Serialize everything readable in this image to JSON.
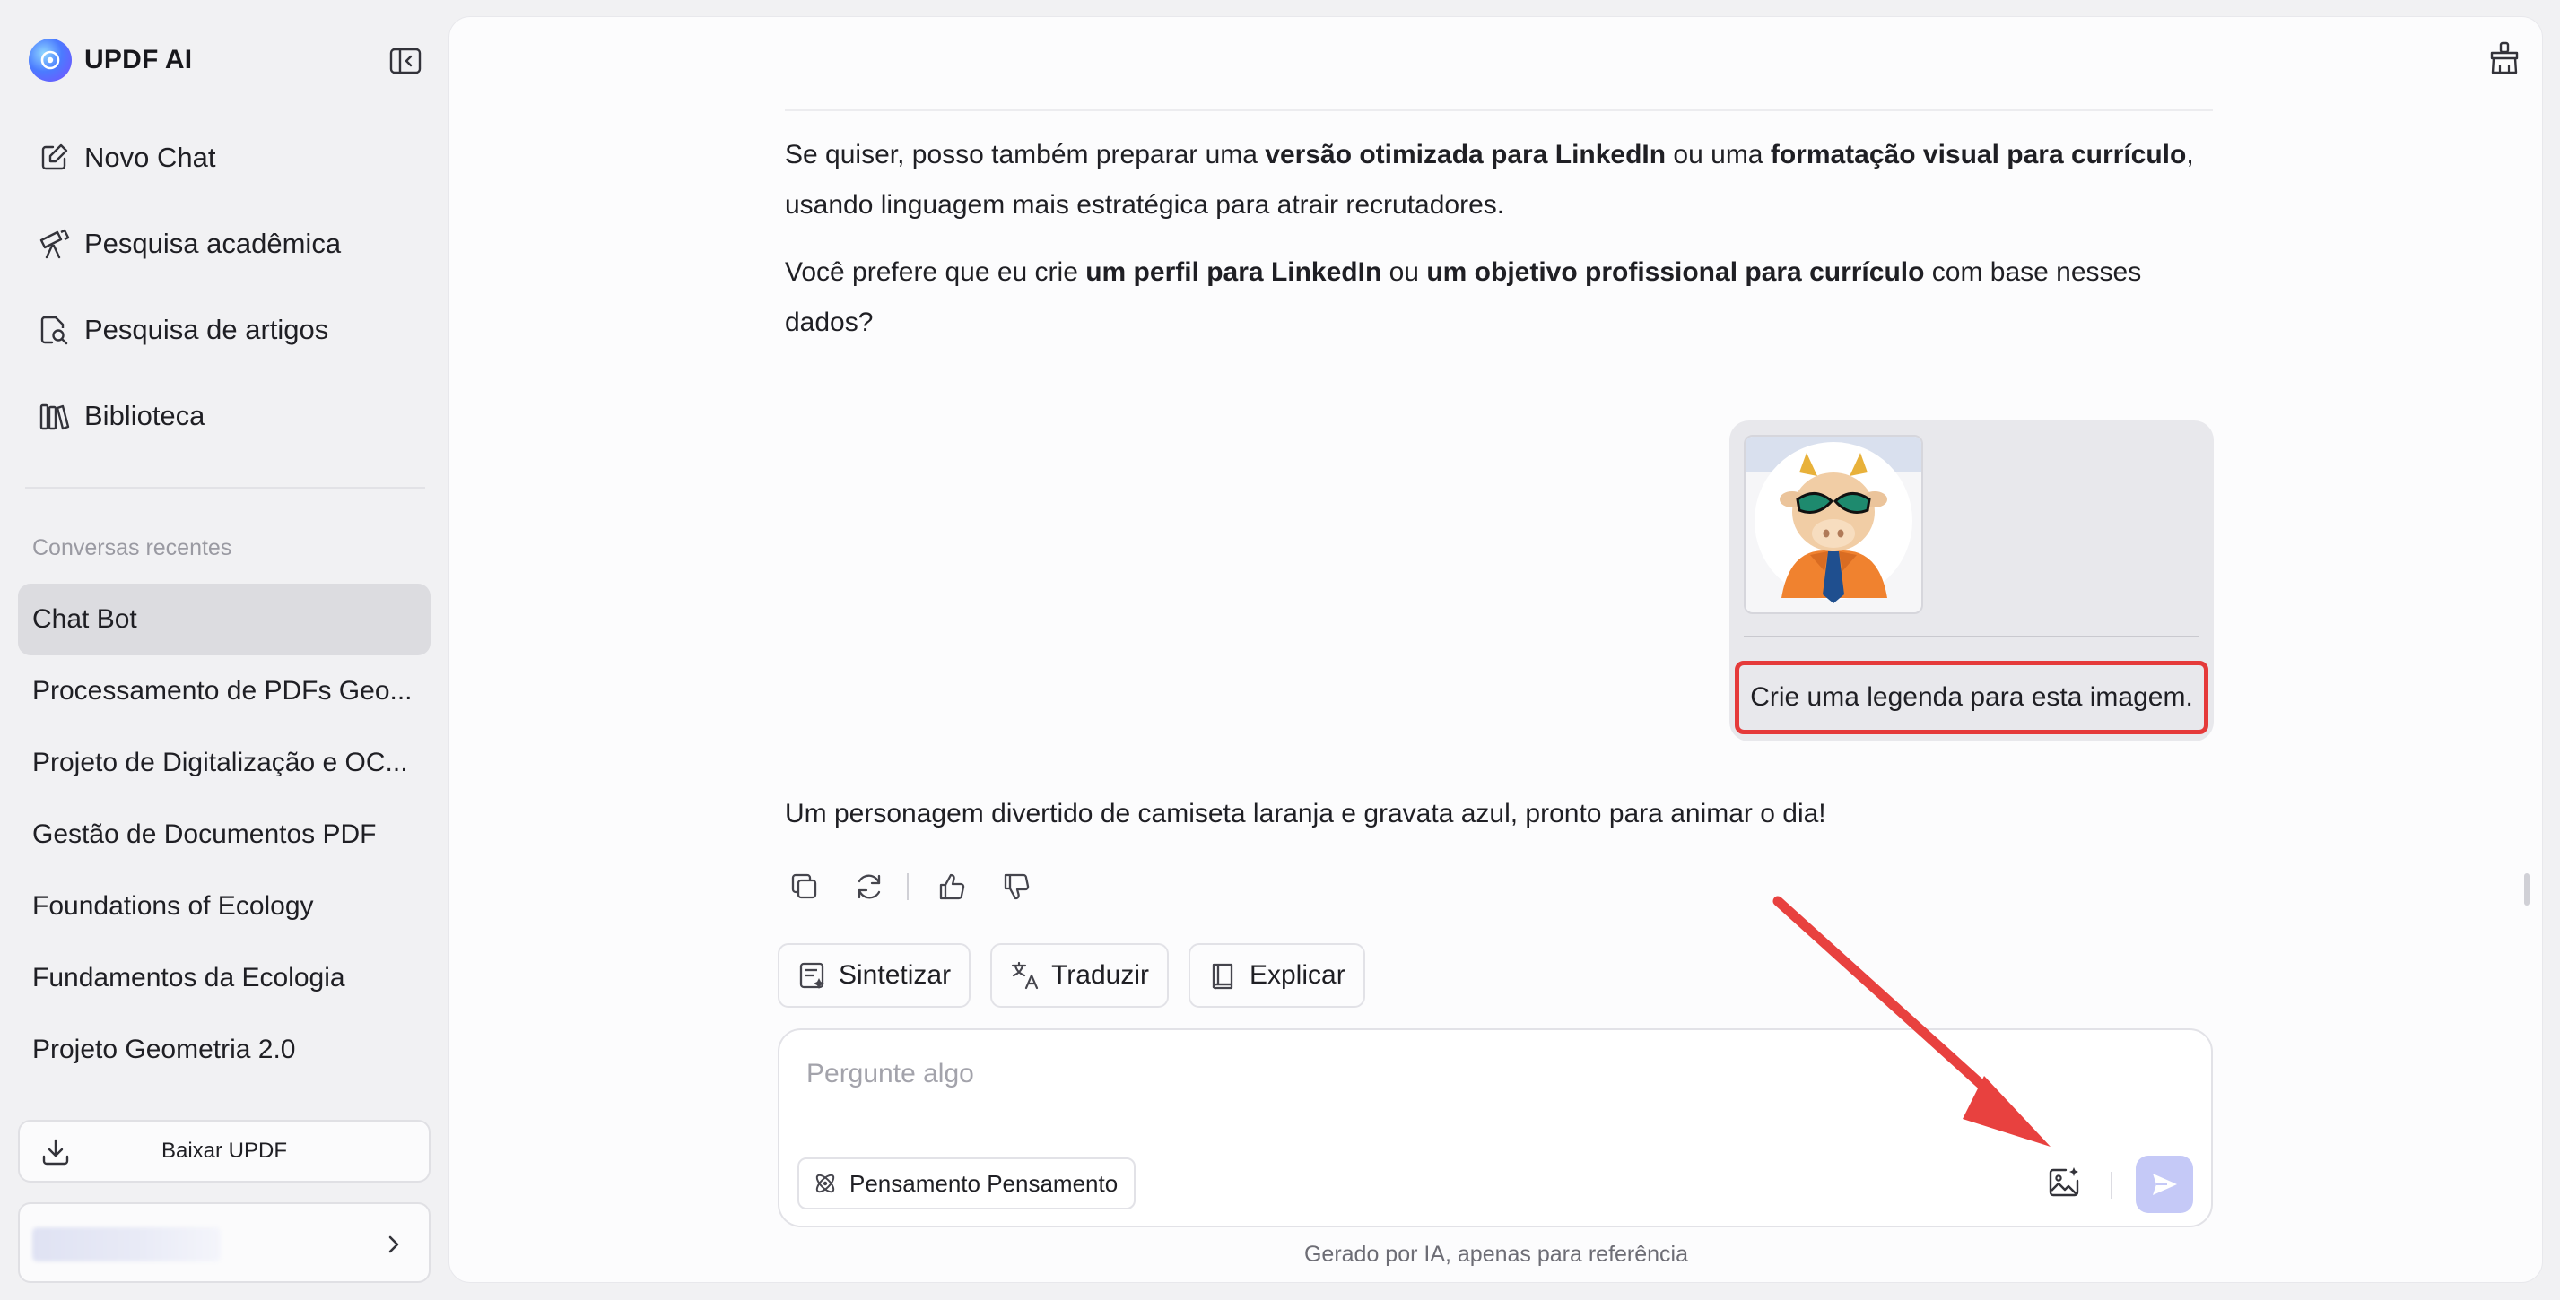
{
  "brand": {
    "name": "UPDF AI"
  },
  "nav": [
    {
      "label": "Novo Chat",
      "icon": "new-chat-icon"
    },
    {
      "label": "Pesquisa acadêmica",
      "icon": "telescope-icon"
    },
    {
      "label": "Pesquisa de artigos",
      "icon": "article-search-icon"
    },
    {
      "label": "Biblioteca",
      "icon": "library-icon"
    }
  ],
  "recent": {
    "label": "Conversas recentes",
    "items": [
      "Chat Bot",
      "Processamento de PDFs Geo...",
      "Projeto de Digitalização e OC...",
      "Gestão de Documentos PDF",
      "Foundations of Ecology",
      "Fundamentos da Ecologia",
      "Projeto Geometria 2.0"
    ],
    "active_index": 0
  },
  "sidebar_footer": {
    "download_label": "Baixar UPDF"
  },
  "chat": {
    "para1": {
      "t1": "Se quiser, posso também preparar uma ",
      "b1": "versão otimizada para LinkedIn",
      "t2": " ou uma ",
      "b2": "formatação visual para currículo",
      "t3": ", usando linguagem mais estratégica para atrair recrutadores."
    },
    "para2": {
      "t1": "Você prefere que eu crie ",
      "b1": "um perfil para LinkedIn",
      "t2": " ou ",
      "b2": "um objetivo profissional para currículo",
      "t3": " com base nesses dados?"
    },
    "user_prompt": "Crie uma legenda para esta imagem.",
    "answer": "Um personagem divertido de camiseta laranja e gravata azul, pronto para animar o dia!"
  },
  "quick_actions": [
    {
      "label": "Sintetizar",
      "icon": "summarize-icon"
    },
    {
      "label": "Traduzir",
      "icon": "translate-icon"
    },
    {
      "label": "Explicar",
      "icon": "book-icon"
    }
  ],
  "composer": {
    "placeholder": "Pergunte algo",
    "think_label": "Pensamento Pensamento"
  },
  "footnote": "Gerado por IA, apenas para referência",
  "colors": {
    "accent_send": "#c5c9f7",
    "highlight_box": "#e53a3a",
    "annotation_arrow": "#e8413f",
    "active_item_bg": "#dcdce0"
  }
}
